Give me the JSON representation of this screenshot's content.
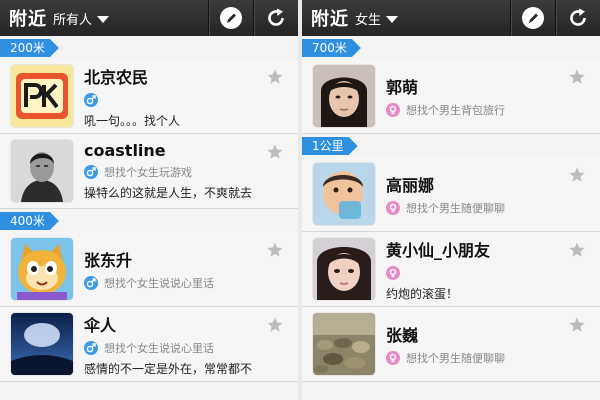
{
  "panels": [
    {
      "title": "附近",
      "filter": "所有人",
      "groups": [
        {
          "distance": "200米",
          "users": [
            {
              "name": "北京农民",
              "gender": "male",
              "seeking": "",
              "message": "吼一句。。。找个人",
              "avatar": "pk-logo"
            },
            {
              "name": "coastline",
              "gender": "male",
              "seeking": "想找个女生玩游戏",
              "message": "操特么的这就是人生，不爽就去",
              "avatar": "man-bw-photo"
            }
          ]
        },
        {
          "distance": "400米",
          "users": [
            {
              "name": "张东升",
              "gender": "male",
              "seeking": "想找个女生说说心里话",
              "message": "",
              "avatar": "cartoon-cat"
            },
            {
              "name": "伞人",
              "gender": "male",
              "seeking": "想找个女生说说心里话",
              "message": "感情的不一定是外在，常常都不",
              "avatar": "night-sky-photo"
            }
          ]
        }
      ]
    },
    {
      "title": "附近",
      "filter": "女生",
      "groups": [
        {
          "distance": "700米",
          "users": [
            {
              "name": "郭萌",
              "gender": "female",
              "seeking": "想找个男生背包旅行",
              "message": "",
              "avatar": "girl-photo"
            }
          ]
        },
        {
          "distance": "1公里",
          "users": [
            {
              "name": "高丽娜",
              "gender": "female",
              "seeking": "想找个男生随便聊聊",
              "message": "",
              "avatar": "baby-photo"
            },
            {
              "name": "黄小仙_小朋友",
              "gender": "female",
              "seeking": "",
              "message": "约炮的滚蛋！",
              "avatar": "girl-closeup-photo"
            },
            {
              "name": "张巍",
              "gender": "female",
              "seeking": "想找个男生随便聊聊",
              "message": "",
              "avatar": "pebbles-photo"
            }
          ]
        }
      ]
    }
  ],
  "icons": {
    "edit": "pencil-icon",
    "refresh": "refresh-icon",
    "favorite": "star-icon",
    "male": "male-symbol-icon",
    "female": "female-symbol-icon"
  },
  "colors": {
    "header": "#2a2a2a",
    "section_tag": "#2f8fe0",
    "male": "#3a9be8",
    "female": "#e68bc4",
    "star": "#bdbdbd"
  }
}
